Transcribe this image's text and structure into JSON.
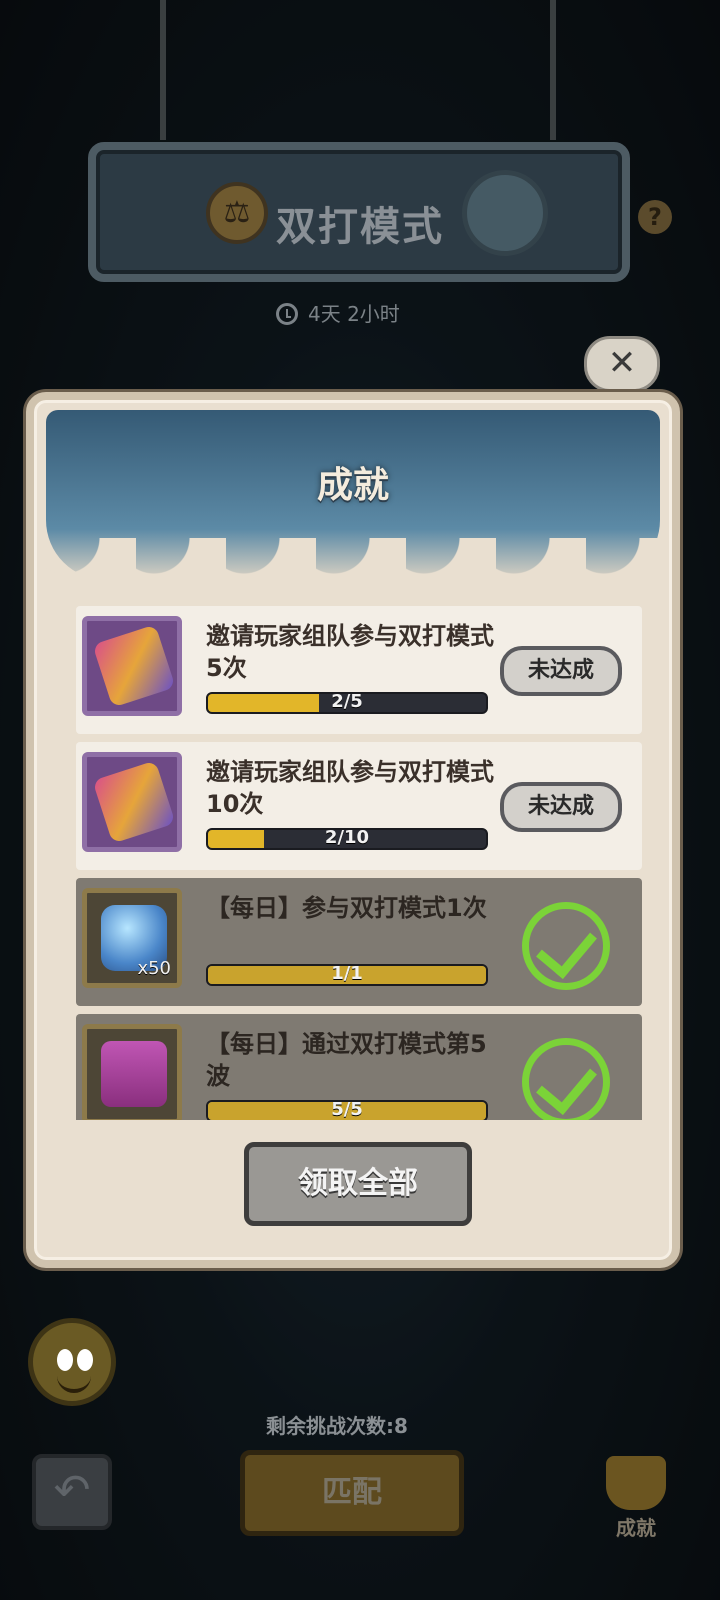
{
  "header": {
    "title": "双打模式",
    "timer": "4天  2小时",
    "help": "?"
  },
  "panel": {
    "title": "成就",
    "close_glyph": "✕",
    "claim_all_label": "领取全部"
  },
  "achievements": [
    {
      "text": "邀请玩家组队参与双打模式5次",
      "progress_label": "2/5",
      "progress": 0.4,
      "status": "未达成",
      "reward_icon": "ticket-icon"
    },
    {
      "text": "邀请玩家组队参与双打模式10次",
      "progress_label": "2/10",
      "progress": 0.2,
      "status": "未达成",
      "reward_icon": "ticket-icon"
    },
    {
      "text": "【每日】参与双打模式1次",
      "progress_label": "1/1",
      "progress": 1.0,
      "reward_icon": "diamond-icon",
      "reward_qty": "x50",
      "completed": true
    },
    {
      "text": "【每日】通过双打模式第5波",
      "progress_label": "5/5",
      "progress": 1.0,
      "reward_icon": "chest-icon",
      "completed": true
    }
  ],
  "footer": {
    "remaining": "剩余挑战次数:8",
    "match_label": "匹配",
    "achievements_tab": "成就"
  },
  "colors": {
    "progress_fill": "#e2b629",
    "check_green": "#7bd338"
  }
}
